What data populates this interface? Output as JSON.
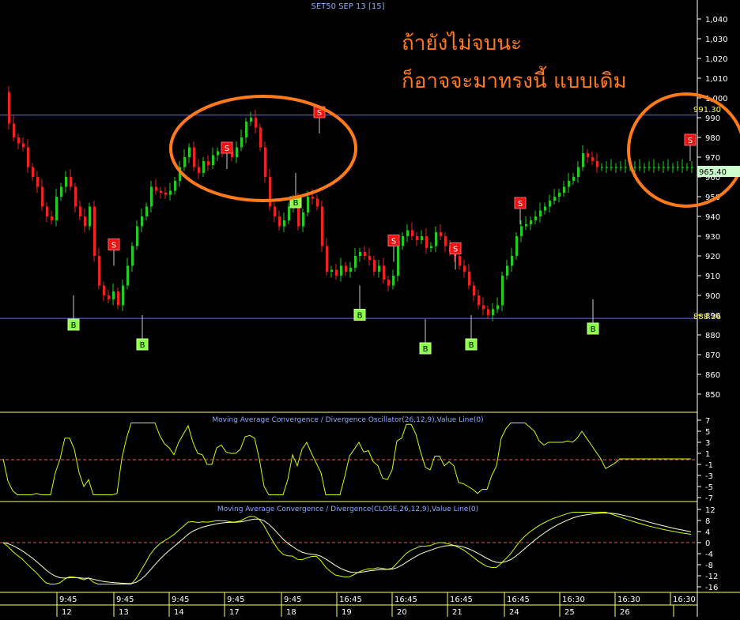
{
  "title": "SET50 SEP 13   [15]",
  "annotation": {
    "line1": "ถ้ายังไม่จบนะ",
    "line2": "ก็อาจจะมาทรงนี้ แบบเดิม",
    "color": "#ff7a1a"
  },
  "price_panel": {
    "yticks": [
      "1,040",
      "1,030",
      "1,020",
      "1,010",
      "1,000",
      "990",
      "980",
      "970",
      "960",
      "950",
      "940",
      "930",
      "920",
      "910",
      "900",
      "890",
      "880",
      "870",
      "860",
      "850"
    ],
    "resistance": {
      "value": 991.3,
      "label": "991.30"
    },
    "support": {
      "value": 888.36,
      "label": "888.36"
    },
    "last_price": {
      "value": 965.4,
      "label": "965.40"
    }
  },
  "osc_panel": {
    "title": "Moving Average Convergence / Divergence Oscillator(26,12,9),Value Line(0)",
    "yticks": [
      "7",
      "5",
      "3",
      "1",
      "-1",
      "-3",
      "-5",
      "-7"
    ]
  },
  "macd_panel": {
    "title": "Moving Average Convergence / Divergence(CLOSE,26,12,9),Value Line(0)",
    "yticks": [
      "12",
      "8",
      "4",
      "0",
      "-4",
      "-8",
      "-12",
      "-16"
    ]
  },
  "xaxis": {
    "times": [
      "9:45",
      "9:45",
      "9:45",
      "9:45",
      "9:45",
      "16:45",
      "16:45",
      "16:45",
      "16:45",
      "16:30",
      "16:30",
      "16:30"
    ],
    "days": [
      "12",
      "13",
      "14",
      "17",
      "18",
      "19",
      "20",
      "21",
      "24",
      "25",
      "26"
    ]
  },
  "colors": {
    "up": "#22cc22",
    "down": "#ee2222",
    "line": "#6666ff",
    "panel_border": "#ffff66",
    "text": "#ffffff",
    "osc": "#ccff00",
    "signal": "#ffffcc",
    "zero": "#ff5555"
  },
  "chart_data": {
    "type": "line",
    "x": [
      0,
      6,
      12,
      18,
      24,
      30,
      36,
      42,
      48,
      54,
      60,
      66,
      72,
      78,
      84,
      90,
      96,
      102,
      108,
      114,
      120,
      126,
      132,
      138,
      144,
      150,
      156,
      162,
      168,
      174,
      180,
      186,
      192,
      198,
      204,
      210,
      216,
      222,
      228,
      234,
      240,
      246,
      252,
      258,
      264,
      270,
      276,
      282,
      288,
      294,
      300,
      306,
      312,
      318,
      324,
      330,
      336,
      342,
      348,
      354,
      360,
      366,
      372,
      378,
      384,
      390,
      396,
      402,
      408,
      414,
      420,
      426,
      432,
      438,
      444,
      450,
      456,
      462,
      468,
      474,
      480,
      486,
      492,
      498,
      504,
      510,
      516,
      522,
      528,
      534,
      540,
      546,
      552,
      558,
      564,
      570,
      576,
      582,
      588,
      594,
      600,
      606,
      612,
      618,
      624,
      630,
      636,
      642,
      648,
      654,
      660,
      666,
      672,
      678,
      684,
      690,
      696,
      702,
      708,
      714,
      720,
      726,
      732,
      738,
      744,
      750,
      756,
      762,
      768,
      774,
      780,
      786,
      792,
      798,
      804,
      810,
      816,
      822,
      828,
      834,
      840,
      846,
      852,
      858,
      864,
      870,
      876
    ],
    "series": [
      {
        "values": [
          1003,
          987,
          980,
          977,
          975,
          965,
          960,
          955,
          945,
          940,
          938,
          950,
          955,
          960,
          955,
          945,
          940,
          935,
          945,
          920,
          905,
          900,
          898,
          902,
          895,
          905,
          915,
          925,
          935,
          940,
          945,
          955,
          953,
          952,
          951,
          953,
          958,
          965,
          970,
          975,
          965,
          962,
          968,
          966,
          971,
          973,
          972,
          973,
          970,
          975,
          980,
          988,
          990,
          985,
          975,
          960,
          945,
          940,
          935,
          938,
          945,
          948,
          935,
          942,
          950,
          949,
          945,
          925,
          912,
          913,
          910,
          915,
          912,
          914,
          920,
          922,
          920,
          918,
          912,
          915,
          908,
          905,
          910,
          925,
          930,
          933,
          930,
          928,
          930,
          924,
          925,
          932,
          930,
          925,
          922,
          920,
          915,
          912,
          905,
          900,
          895,
          893,
          890,
          893,
          895,
          910,
          915,
          920,
          930,
          935,
          936,
          938,
          940,
          943,
          945,
          948,
          950,
          952,
          955,
          958,
          960,
          965,
          972,
          970,
          968,
          965,
          965,
          965,
          965,
          965,
          965,
          965,
          965,
          965,
          965,
          965,
          965,
          965,
          965,
          965,
          965,
          965,
          965,
          965,
          965,
          965
        ]
      }
    ],
    "ylim": [
      845,
      1045
    ],
    "hlines": [
      991.3,
      888.36
    ],
    "buy_markers": [
      [
        93,
        888
      ],
      [
        180,
        878
      ],
      [
        374,
        950
      ],
      [
        455,
        893
      ],
      [
        538,
        876
      ],
      [
        596,
        878
      ],
      [
        750,
        886
      ]
    ],
    "sell_markers": [
      [
        144,
        923
      ],
      [
        287,
        972
      ],
      [
        404,
        990
      ],
      [
        498,
        925
      ],
      [
        576,
        921
      ],
      [
        658,
        944
      ],
      [
        873,
        976
      ]
    ]
  }
}
